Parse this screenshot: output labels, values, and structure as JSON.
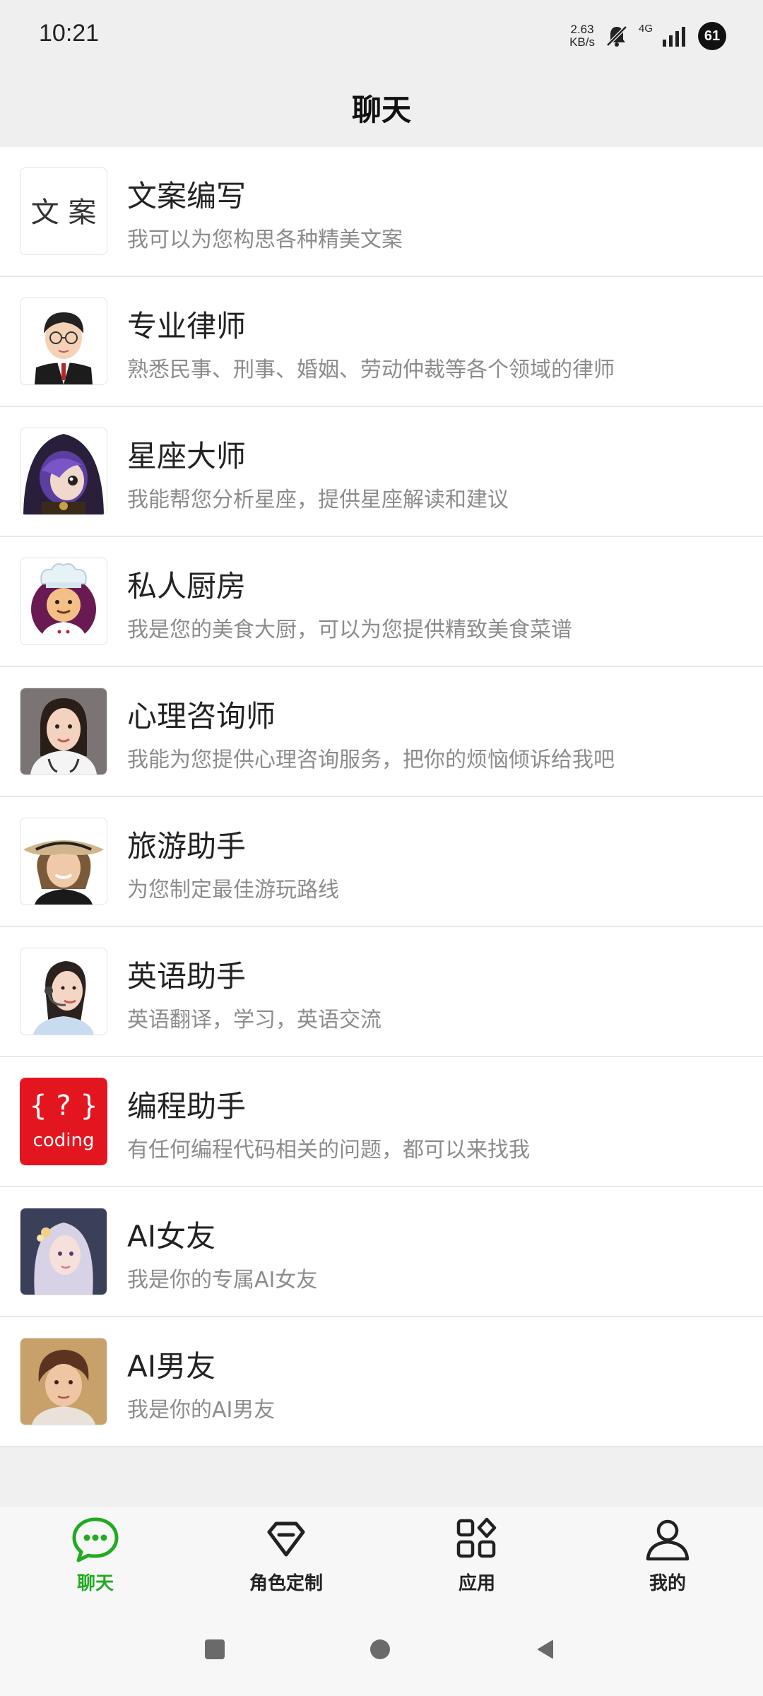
{
  "status": {
    "time": "10:21",
    "net_speed_value": "2.63",
    "net_speed_unit": "KB/s",
    "network": "4G",
    "battery": "61"
  },
  "header": {
    "title": "聊天"
  },
  "items": [
    {
      "name": "文案编写",
      "desc": "我可以为您构思各种精美文案",
      "avatar_text": "文 案"
    },
    {
      "name": "专业律师",
      "desc": "熟悉民事、刑事、婚姻、劳动仲裁等各个领域的律师"
    },
    {
      "name": "星座大师",
      "desc": "我能帮您分析星座，提供星座解读和建议"
    },
    {
      "name": "私人厨房",
      "desc": "我是您的美食大厨，可以为您提供精致美食菜谱"
    },
    {
      "name": "心理咨询师",
      "desc": "我能为您提供心理咨询服务，把你的烦恼倾诉给我吧"
    },
    {
      "name": "旅游助手",
      "desc": "为您制定最佳游玩路线"
    },
    {
      "name": "英语助手",
      "desc": "英语翻译，学习，英语交流"
    },
    {
      "name": "编程助手",
      "desc": "有任何编程代码相关的问题，都可以来找我",
      "avatar_text": "coding"
    },
    {
      "name": "AI女友",
      "desc": "我是你的专属AI女友"
    },
    {
      "name": "AI男友",
      "desc": "我是你的AI男友"
    }
  ],
  "tabs": [
    {
      "label": "聊天",
      "icon": "chat-bubble-icon",
      "active": true
    },
    {
      "label": "角色定制",
      "icon": "diamond-icon",
      "active": false
    },
    {
      "label": "应用",
      "icon": "apps-grid-icon",
      "active": false
    },
    {
      "label": "我的",
      "icon": "person-icon",
      "active": false
    }
  ],
  "colors": {
    "accent": "#22aa22",
    "coding_red": "#e3151f"
  }
}
